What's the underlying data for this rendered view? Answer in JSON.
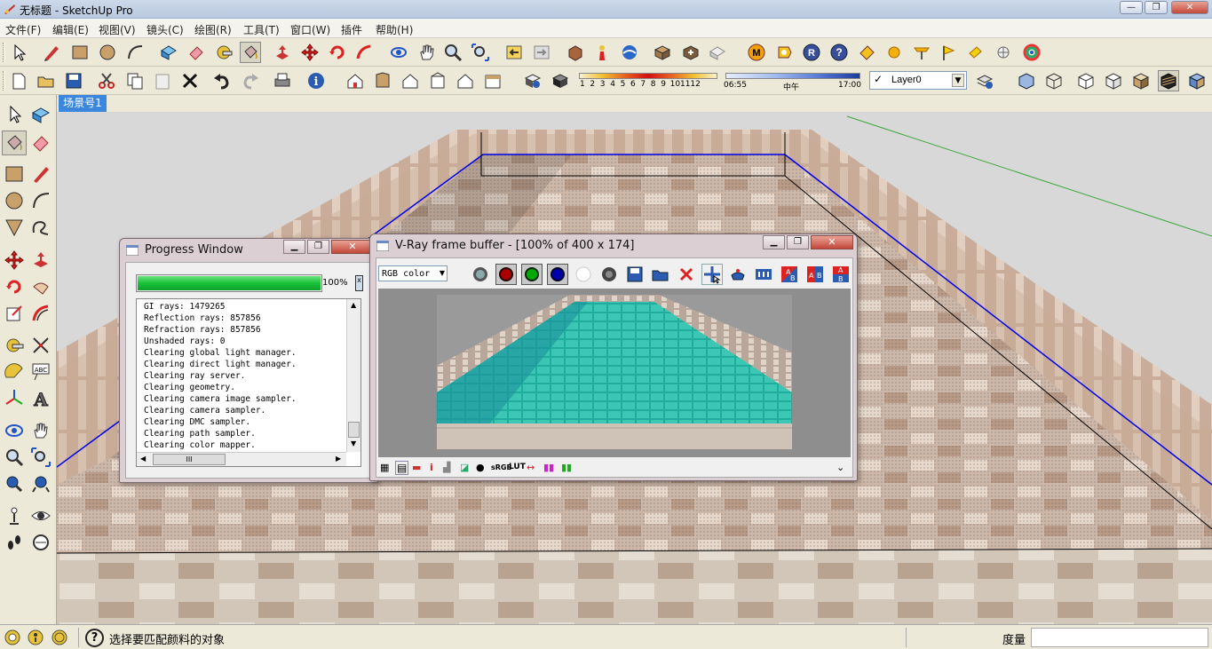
{
  "window": {
    "title": "无标题 - SketchUp Pro",
    "min": "—",
    "max": "❐",
    "close": "✕"
  },
  "menu": [
    "文件(F)",
    "编辑(E)",
    "视图(V)",
    "镜头(C)",
    "绘图(R)",
    "工具(T)",
    "窗口(W)",
    "插件",
    "帮助(H)"
  ],
  "shadow": {
    "months": [
      "1",
      "2",
      "3",
      "4",
      "5",
      "6",
      "7",
      "8",
      "9",
      "10",
      "11",
      "12"
    ],
    "time_start": "06:55",
    "time_mid": "中午",
    "time_end": "17:00"
  },
  "layer": {
    "name": "Layer0"
  },
  "scene_tab": "场景号1",
  "progress": {
    "title": "Progress Window",
    "percent_label": "100%",
    "percent": 1.0,
    "log": [
      "GI rays: 1479265",
      "Reflection rays: 857856",
      "Refraction rays: 857856",
      "Unshaded rays: 0",
      "Clearing global light manager.",
      "Clearing direct light manager.",
      "Clearing ray server.",
      "Clearing geometry.",
      "Clearing camera image sampler.",
      "Clearing camera sampler.",
      "Clearing DMC sampler.",
      "Clearing path sampler.",
      "Clearing color mapper."
    ],
    "scroll_mark": "III"
  },
  "vfb": {
    "title": "V-Ray frame buffer - [100% of 400 x 174]",
    "channel": "RGB color",
    "bottom_labels": [
      "i",
      "sRGB",
      "LUT"
    ]
  },
  "status": {
    "hint": "选择要匹配颜料的对象",
    "measure_label": "度量",
    "help_symbol": "?"
  },
  "colors": {
    "accent": "#3b87de",
    "progress": "#19c23a",
    "title_bg": "#dccfd3"
  }
}
